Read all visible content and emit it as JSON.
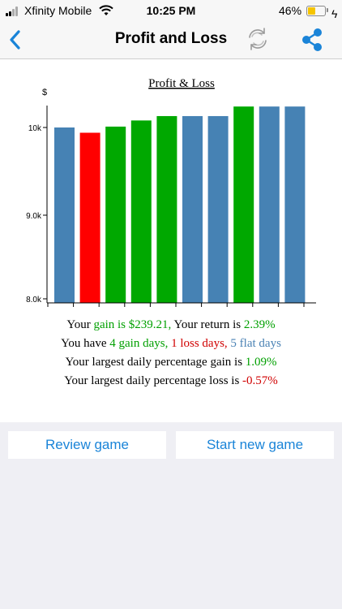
{
  "status_bar": {
    "carrier": "Xfinity Mobile",
    "time": "10:25 PM",
    "battery": "46%",
    "battery_level": 0.46
  },
  "nav": {
    "title": "Profit and Loss",
    "back_icon": "chevron-left-icon",
    "refresh_icon": "refresh-icon",
    "share_icon": "share-icon",
    "accent": "#1a84d8"
  },
  "chart_data": {
    "type": "bar",
    "title": "Profit & Loss",
    "ylabel": "$",
    "yticks": [
      "8.0k",
      "9.0k",
      "10k"
    ],
    "ytick_values": [
      8000,
      9000,
      10000
    ],
    "ylim": [
      8000,
      10250
    ],
    "values": [
      10000,
      9940,
      10010,
      10080,
      10130,
      10130,
      10130,
      10239,
      10239,
      10239
    ],
    "colors": [
      "#4682b4",
      "#ff0000",
      "#00a800",
      "#00a800",
      "#00a800",
      "#4682b4",
      "#4682b4",
      "#00a800",
      "#4682b4",
      "#4682b4"
    ]
  },
  "stats": {
    "line1": {
      "a": "Your",
      "b": "gain is $239.21,",
      "c": "Your return is",
      "d": "2.39%"
    },
    "line2": {
      "a": "You have",
      "b": "4 gain days,",
      "c": "1 loss days,",
      "d": "5 flat days"
    },
    "line3": {
      "a": "Your largest daily percentage gain is",
      "b": "1.09%"
    },
    "line4": {
      "a": "Your largest daily percentage loss is",
      "b": "-0.57%"
    }
  },
  "buttons": {
    "review": "Review game",
    "start": "Start new game"
  }
}
